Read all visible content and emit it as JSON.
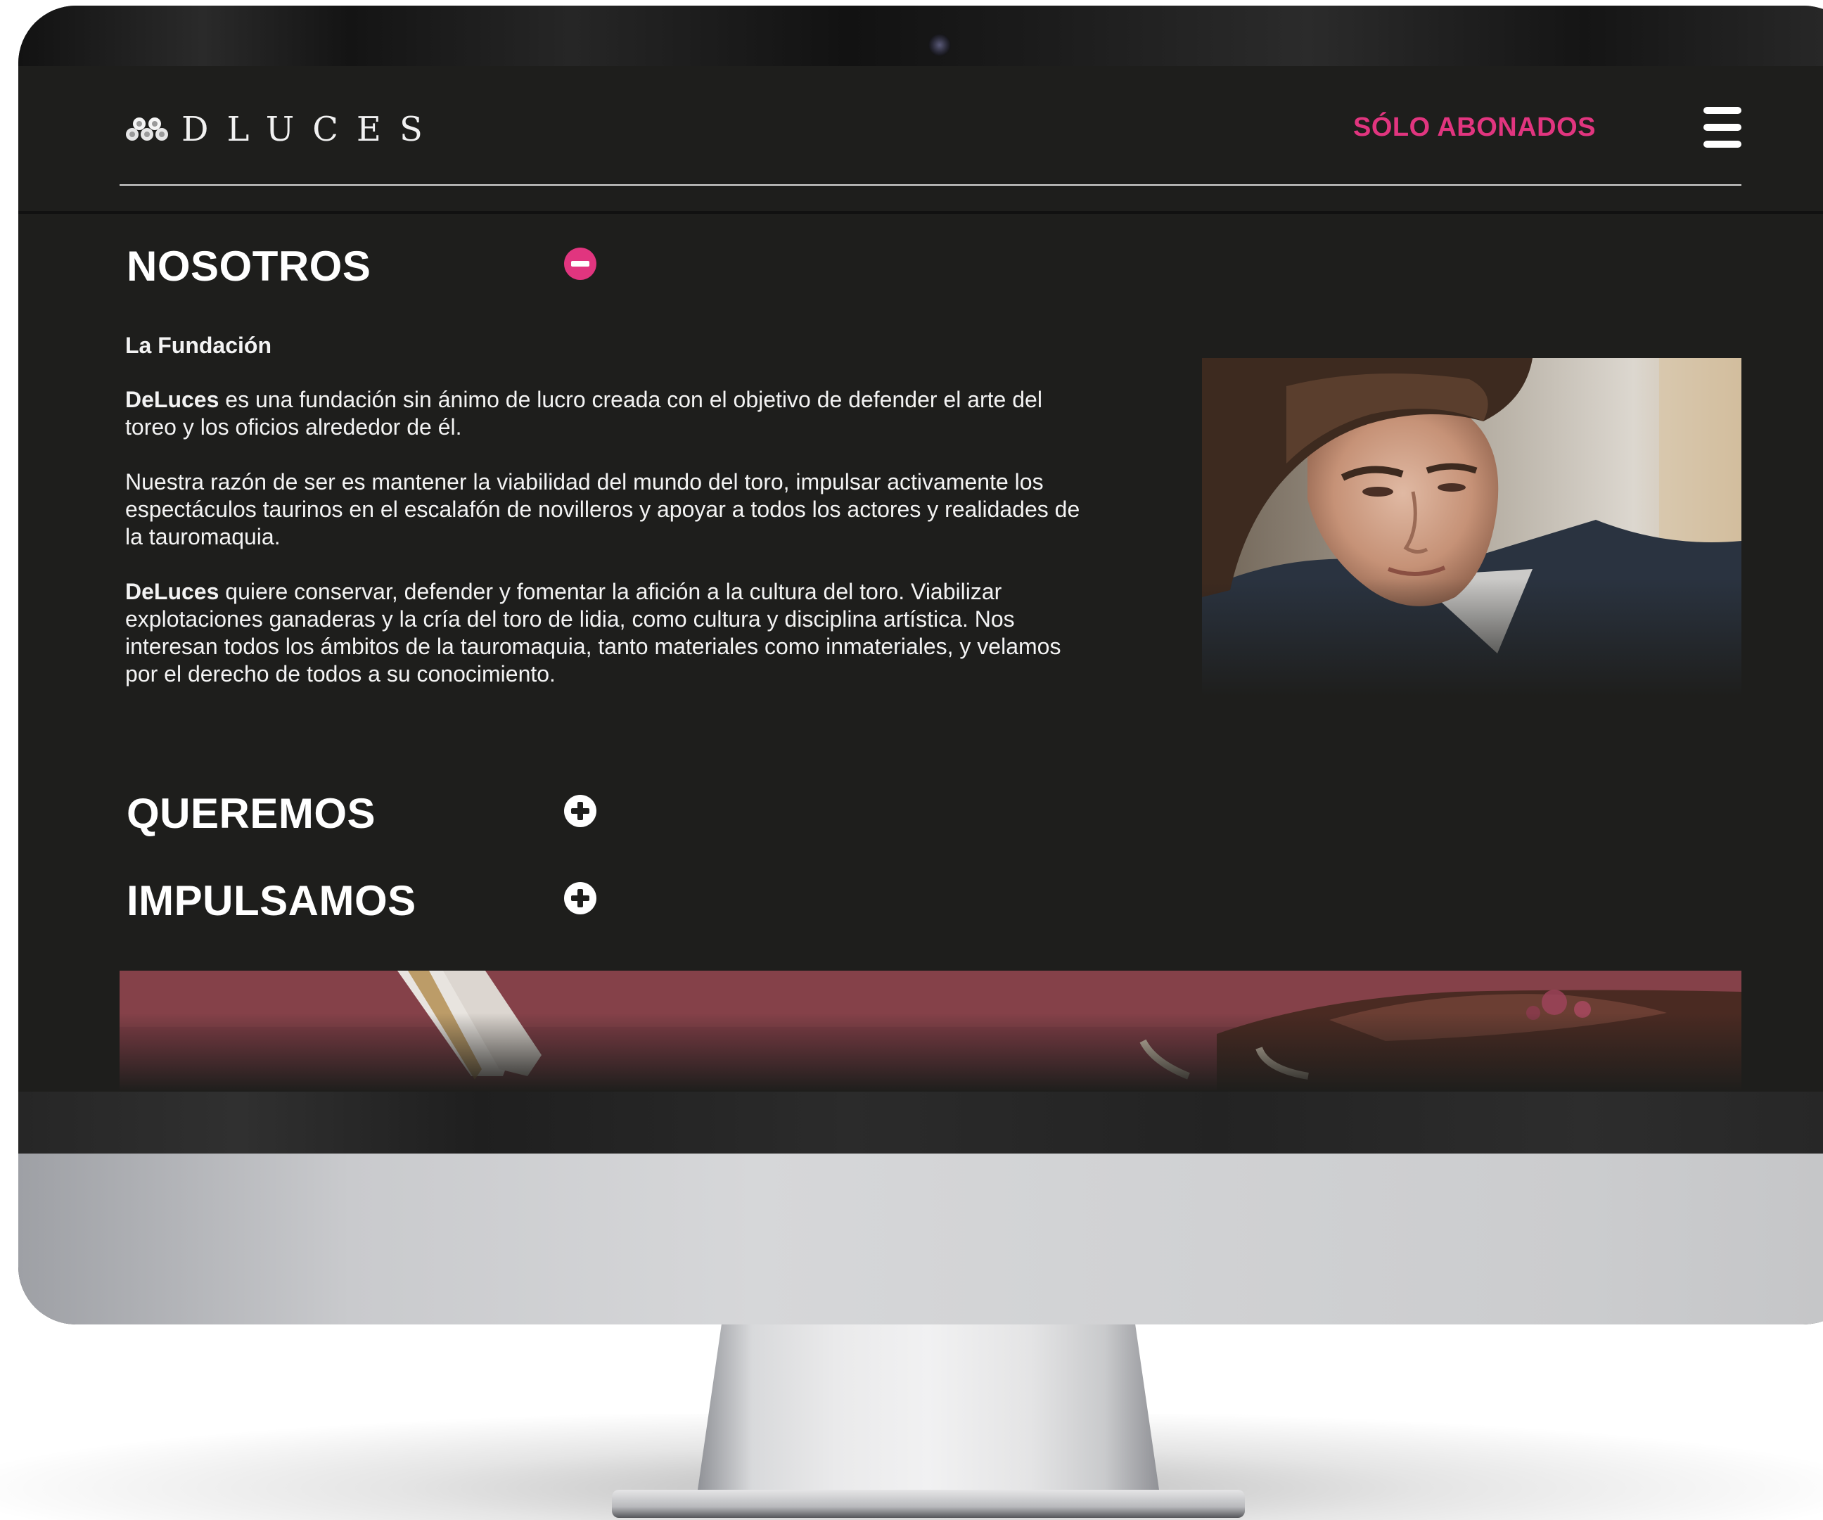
{
  "header": {
    "logo_text": "DLUCES",
    "subscribers_link": "SÓLO ABONADOS",
    "menu_icon": "hamburger-menu-icon",
    "accent_color": "#e1357f"
  },
  "sections": [
    {
      "title": "NOSOTROS",
      "state": "expanded",
      "toggle_icon": "minus-circle-icon",
      "subtitle": "La Fundación",
      "paragraphs": [
        {
          "lead": "DeLuces",
          "text": " es una fundación sin ánimo de lucro creada con el objetivo de defender el arte del toreo y los oficios alrededor de él."
        },
        {
          "lead": "",
          "text": "Nuestra razón de ser es mantener la viabilidad del mundo del toro, impulsar activamente los espectáculos taurinos en el escalafón de novilleros y apoyar a todos los actores y realidades de la tauromaquia."
        },
        {
          "lead": "DeLuces",
          "text": " quiere conservar, defender y fomentar la afición a la cultura del toro. Viabilizar explotaciones ganaderas y la cría del toro de lidia, como cultura y disciplina artística. Nos interesan todos los ámbitos de la tauromaquia, tanto materiales como inmateriales, y velamos por el derecho de todos a su conocimiento."
        }
      ],
      "image": "portrait-photo"
    },
    {
      "title": "QUEREMOS",
      "state": "collapsed",
      "toggle_icon": "plus-circle-icon"
    },
    {
      "title": "IMPULSAMOS",
      "state": "collapsed",
      "toggle_icon": "plus-circle-icon"
    }
  ],
  "banner": {
    "image": "bullfight-banner-photo"
  },
  "colors": {
    "background": "#1e1e1c",
    "text": "#ffffff",
    "accent": "#e1357f"
  }
}
